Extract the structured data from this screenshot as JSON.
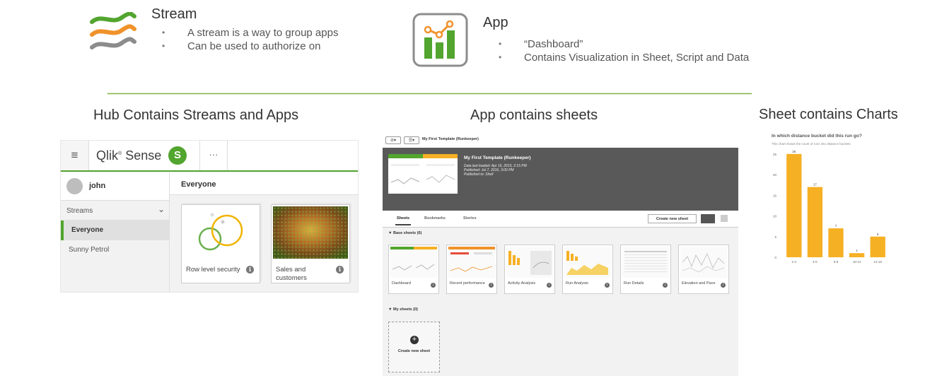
{
  "stream_legend": {
    "title": "Stream",
    "bullets": [
      "A stream is a way to group apps",
      "Can be used to authorize on"
    ]
  },
  "app_legend": {
    "title": "App",
    "bullets": [
      "“Dashboard”",
      "Contains Visualization in Sheet, Script and Data"
    ]
  },
  "sections": {
    "hub": "Hub Contains Streams and Apps",
    "app": "App contains sheets",
    "sheet": "Sheet contains Charts"
  },
  "hub": {
    "brand": "Qlik",
    "brand_mark": "®",
    "brand_suffix": "Sense",
    "logo_letter": "S",
    "menu_icon": "≡",
    "more_icon": "···",
    "user": "john",
    "streams_label": "Streams",
    "streams": [
      "Everyone",
      "Sunny Petrol"
    ],
    "active_stream_title": "Everyone",
    "apps": [
      {
        "name": "Row level security"
      },
      {
        "name": "Sales and customers"
      }
    ]
  },
  "app_overview": {
    "title": "My First Template (Runkeeper)",
    "hero_title": "My First Template (Runkeeper)",
    "data_loaded": "Data last loaded: Apr 16, 2015, 2:15 PM",
    "published": "Published: Jul 7, 2016, 3:00 PM",
    "published_to": "Published to: Shell",
    "tabs": [
      "Sheets",
      "Bookmarks",
      "Stories"
    ],
    "create_sheet_button": "Create new sheet",
    "base_sheets_label": "Base sheets (6)",
    "my_sheets_label": "My sheets (0)",
    "create_sheet_tile": "Create new sheet",
    "sheets": [
      "Dashboard",
      "Recent performance",
      "Activity Analysis",
      "Run Analysis",
      "Run Details",
      "Elevation and Pace"
    ]
  },
  "chart_data": {
    "type": "bar",
    "title": "In which distance bucket did this run go?",
    "subtitle": "This chart shows the count of runs into distance buckets",
    "categories": [
      "2-4",
      "4-6",
      "6-8",
      "10-12",
      "14-16"
    ],
    "values": [
      25,
      17,
      7,
      1,
      5
    ],
    "yticks": [
      0,
      5,
      10,
      15,
      20,
      25
    ],
    "ylim": [
      0,
      26
    ],
    "color": "#f6b024",
    "grid": false
  },
  "colors": {
    "qlik_green": "#52a52e",
    "orange": "#f0922b",
    "gray": "#8c8c8c"
  }
}
